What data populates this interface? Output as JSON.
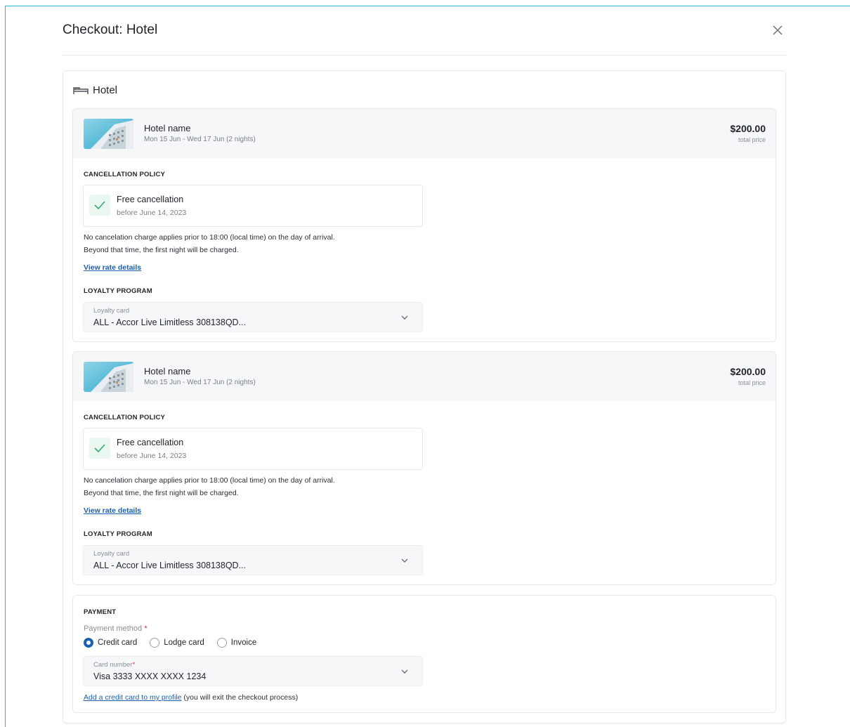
{
  "modal": {
    "title": "Checkout: Hotel",
    "close_icon": "close-icon"
  },
  "section": {
    "title": "Hotel",
    "icon": "bed-icon"
  },
  "hotels": [
    {
      "name": "Hotel name",
      "dates": "Mon 15 Jun - Wed 17 Jun (2 nights)",
      "price": "$200.00",
      "price_label": "total price",
      "cancellation_heading": "CANCELLATION POLICY",
      "cancellation_title": "Free cancellation",
      "cancellation_sub": "before June 14, 2023",
      "policy_line1": "No cancelation charge applies prior to 18:00 (local time) on the day of arrival.",
      "policy_line2": "Beyond that time, the first night will be charged.",
      "rate_link": "View rate details",
      "loyalty_heading": "LOYALTY PROGRAM",
      "loyalty_label": "Loyalty card",
      "loyalty_value": "ALL - Accor Live Limitless 308138QD..."
    },
    {
      "name": "Hotel name",
      "dates": "Mon 15 Jun - Wed 17 Jun (2 nights)",
      "price": "$200.00",
      "price_label": "total price",
      "cancellation_heading": "CANCELLATION POLICY",
      "cancellation_title": "Free cancellation",
      "cancellation_sub": "before June 14, 2023",
      "policy_line1": "No cancelation charge applies prior to 18:00 (local time) on the day of arrival.",
      "policy_line2": "Beyond that time, the first night will be charged.",
      "rate_link": "View rate details",
      "loyalty_heading": "LOYALTY PROGRAM",
      "loyalty_label": "Loyalty card",
      "loyalty_value": "ALL - Accor Live Limitless 308138QD..."
    }
  ],
  "payment": {
    "heading": "PAYMENT",
    "method_label": "Payment method",
    "required_mark": "*",
    "options": [
      "Credit card",
      "Lodge card",
      "Invoice"
    ],
    "selected": "Credit card",
    "card_label": "Card number",
    "card_value": "Visa 3333 XXXX XXXX 1234",
    "add_card_link": "Add a credit card to my profile",
    "add_card_note": "(you will exit the checkout process)"
  },
  "colors": {
    "accent": "#1a5fb4",
    "success": "#3aa876",
    "required": "#d9333f",
    "frame": "#2bb3d8"
  }
}
